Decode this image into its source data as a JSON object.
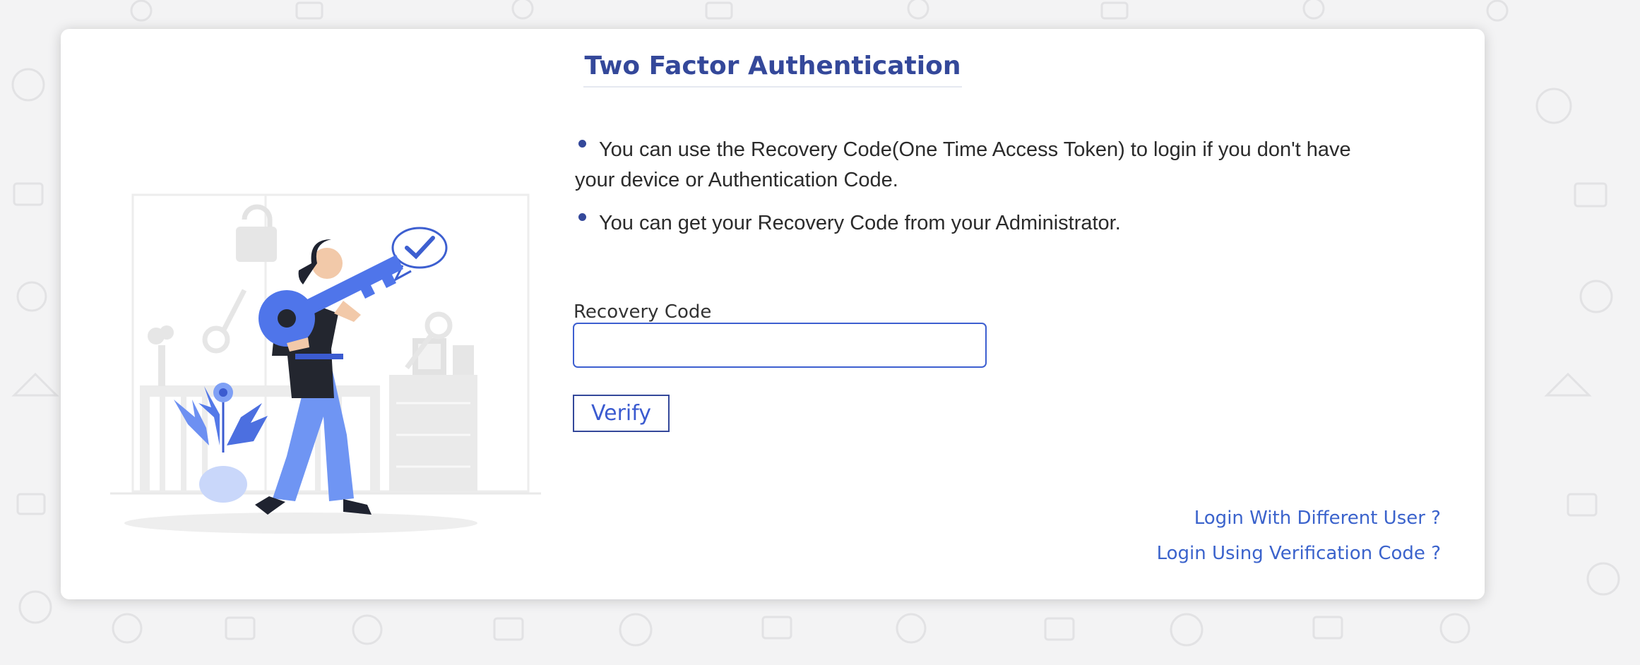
{
  "page": {
    "title": "Two Factor Authentication"
  },
  "info": {
    "items": [
      "You can use the Recovery Code(One Time Access Token) to login if you don't have your device or Authentication Code.",
      "You can get your Recovery Code from your Administrator."
    ]
  },
  "form": {
    "recovery_label": "Recovery Code",
    "recovery_value": "",
    "recovery_placeholder": "",
    "verify_label": "Verify"
  },
  "links": {
    "different_user": "Login With Different User ?",
    "verification_code": "Login Using Verification Code ?"
  },
  "colors": {
    "brand": "#34489a",
    "accent": "#3b63cc",
    "illustration_blue": "#6f95f3",
    "background": "#f3f3f4"
  },
  "illustration": {
    "icon": "person-holding-key-illustration"
  }
}
